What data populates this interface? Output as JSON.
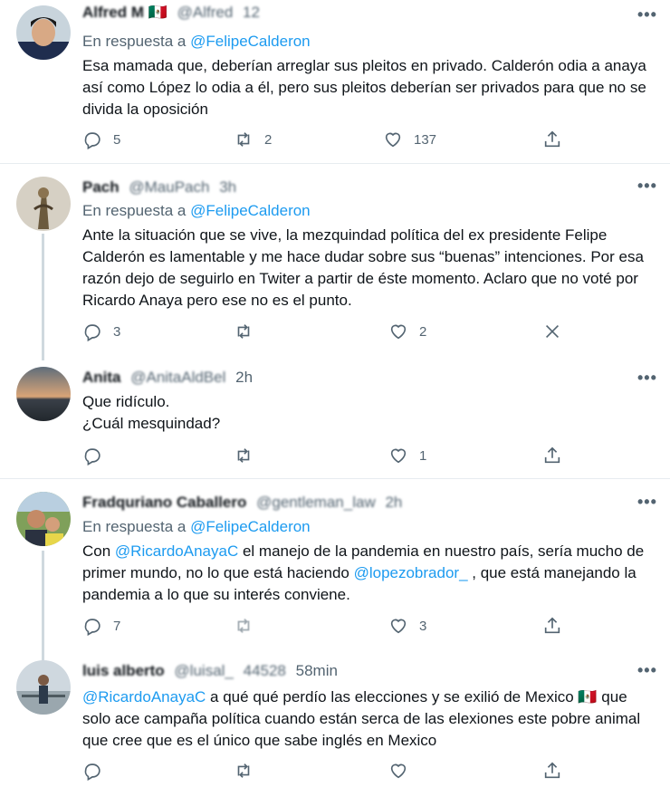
{
  "tweets": [
    {
      "author": "Alfred M",
      "handle": "@Alfred",
      "time": "12",
      "flag": "🇲🇽",
      "reply_prefix": "En respuesta a",
      "reply_handle": "@FelipeCalderon",
      "text": "Esa mamada que, deberían arreglar sus pleitos en privado. Calderón odia a anaya así como López lo odia a él, pero sus pleitos deberían ser privados para que no se divida la oposición",
      "replies": "5",
      "retweets": "2",
      "likes": "137"
    },
    {
      "author": "Pach",
      "handle": "@MauPach",
      "time": "3h",
      "reply_prefix": "En respuesta a",
      "reply_handle": "@FelipeCalderon",
      "text": "Ante la situación que se vive, la mezquindad política del ex presidente Felipe Calderón es lamentable y me hace dudar sobre sus “buenas” intenciones. Por esa razón dejo de seguirlo en Twiter a partir de éste momento. Aclaro que no voté por Ricardo Anaya pero ese no es el punto.",
      "replies": "3",
      "retweets": "",
      "likes": "2"
    },
    {
      "author": "Anita",
      "handle": "@AnitaAldBel",
      "time": "2h",
      "text_line1": "Que ridículo.",
      "text_line2": "¿Cuál mesquindad?",
      "replies": "",
      "retweets": "",
      "likes": "1"
    },
    {
      "author": "Fradquriano Caballero",
      "handle": "@gentleman_law",
      "time": "2h",
      "reply_prefix": "En respuesta a",
      "reply_handle": "@FelipeCalderon",
      "text_a": "Con",
      "mention_1": "@RicardoAnayaC",
      "text_b": " el manejo  de la pandemia en nuestro país, sería mucho de primer mundo, no lo que está haciendo ",
      "mention_2": "@lopezobrador_",
      "text_c": " , que está manejando la pandemia a lo que su interés conviene.",
      "replies": "7",
      "retweets": "",
      "likes": "3"
    },
    {
      "author": "luis alberto",
      "handle": "@luisal_",
      "handle_tail": "44528",
      "time": "58min",
      "mention": "@RicardoAnayaC",
      "text_a": "  a qué qué perdío las elecciones y se exilió de Mexico ",
      "flag": "🇲🇽",
      "text_b": " que solo ace campaña política cuando están serca de las elexiones este pobre animal que cree que es el único que sabe inglés en Mexico",
      "replies": "",
      "retweets": "",
      "likes": ""
    }
  ],
  "more_glyph": "•••"
}
